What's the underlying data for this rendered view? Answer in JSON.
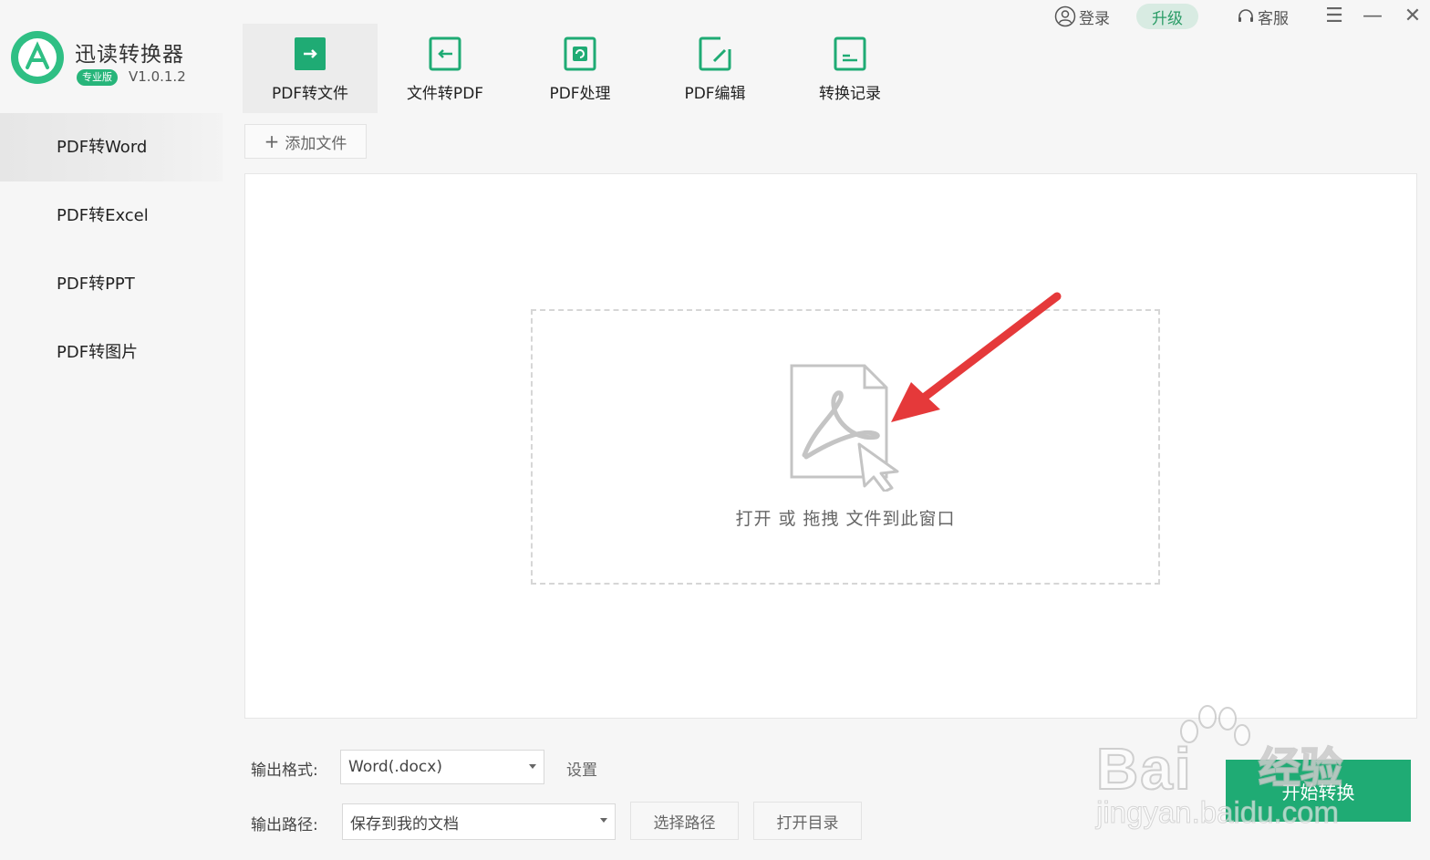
{
  "app": {
    "name": "迅读转换器",
    "edition": "专业版",
    "version": "V1.0.1.2"
  },
  "topbar": {
    "login_label": "登录",
    "upgrade_label": "升级",
    "support_label": "客服"
  },
  "nav": {
    "tabs": [
      {
        "label": "PDF转文件",
        "icon": "pdf-to-file-icon"
      },
      {
        "label": "文件转PDF",
        "icon": "file-to-pdf-icon"
      },
      {
        "label": "PDF处理",
        "icon": "pdf-process-icon"
      },
      {
        "label": "PDF编辑",
        "icon": "pdf-edit-icon"
      },
      {
        "label": "转换记录",
        "icon": "history-icon"
      }
    ],
    "active": "PDF转文件"
  },
  "sidebar": {
    "items": [
      {
        "label": "PDF转Word"
      },
      {
        "label": "PDF转Excel"
      },
      {
        "label": "PDF转PPT"
      },
      {
        "label": "PDF转图片"
      }
    ],
    "active": "PDF转Word"
  },
  "toolbar": {
    "add_file_label": "添加文件"
  },
  "dropzone": {
    "hint": "打开 或 拖拽 文件到此窗口"
  },
  "output": {
    "format_label": "输出格式:",
    "format_value": "Word(.docx)",
    "settings_label": "设置",
    "path_label": "输出路径:",
    "path_value": "保存到我的文档",
    "choose_path_label": "选择路径",
    "open_dir_label": "打开目录"
  },
  "actions": {
    "start_label": "开始转换"
  },
  "watermark": {
    "brand": "Bai",
    "brand_cn": "经验",
    "url": "jingyan.baidu.com"
  },
  "colors": {
    "accent": "#1fab74",
    "annotation_arrow": "#e5393a"
  }
}
